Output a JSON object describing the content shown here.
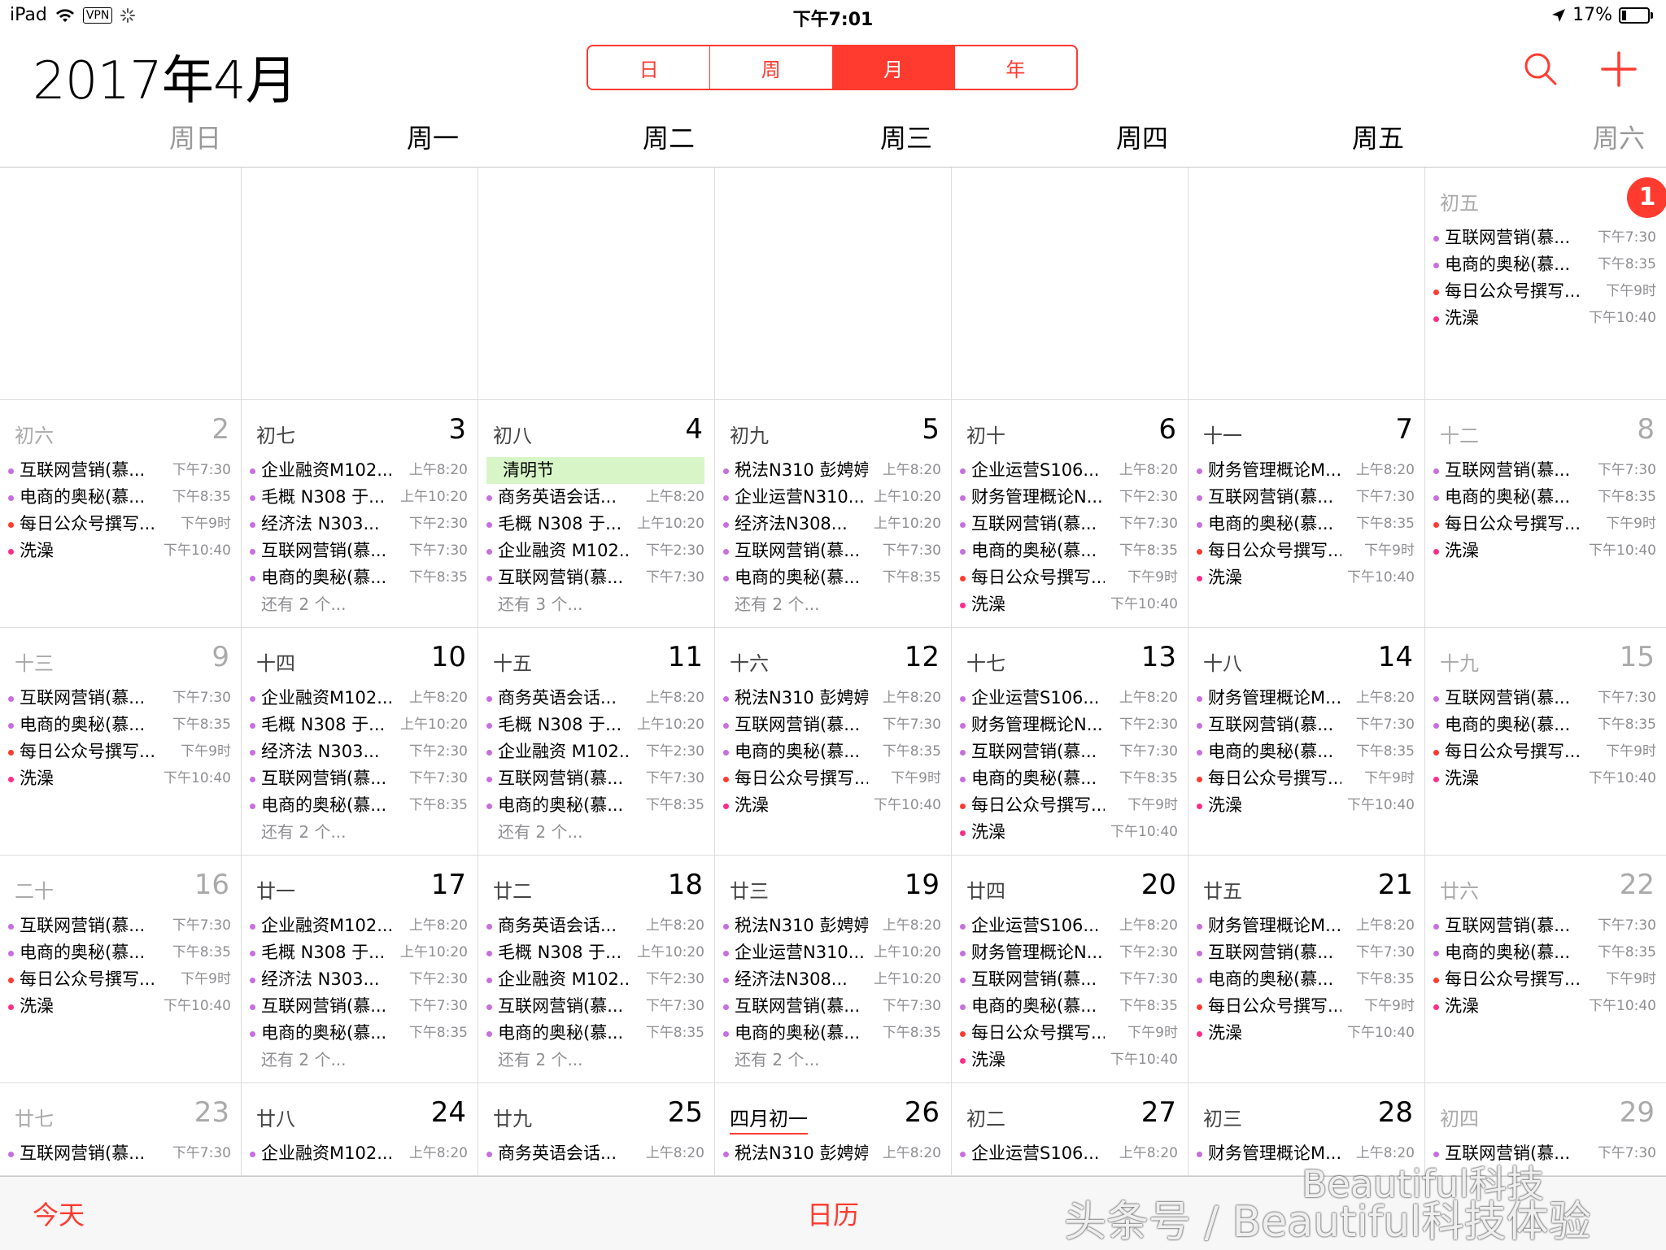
{
  "status": {
    "device": "iPad",
    "vpn": "VPN",
    "time": "下午7:01",
    "battery_text": "17%",
    "battery_level": 0.17
  },
  "header": {
    "title": "2017年4月"
  },
  "segments": [
    {
      "label": "日",
      "active": false
    },
    {
      "label": "周",
      "active": false
    },
    {
      "label": "月",
      "active": true
    },
    {
      "label": "年",
      "active": false
    }
  ],
  "icons": {
    "search": "search-icon",
    "add": "plus-icon",
    "accent": "#ff3b30"
  },
  "weekdays": [
    "周日",
    "周一",
    "周二",
    "周三",
    "周四",
    "周五",
    "周六"
  ],
  "toolbar": {
    "today": "今天",
    "calendars": "日历"
  },
  "watermark": {
    "line1": "Beautiful科技",
    "line2": "头条号 / Beautiful科技体验"
  },
  "weeks": [
    [
      null,
      null,
      null,
      null,
      null,
      null,
      {
        "lunar": "初五",
        "day": "1",
        "today": true,
        "events": [
          {
            "title": "互联网营销(慕...",
            "time": "下午7:30",
            "color": "#c86ee0"
          },
          {
            "title": "电商的奥秘(慕...",
            "time": "下午8:35",
            "color": "#c86ee0"
          },
          {
            "title": "每日公众号撰写...",
            "time": "下午9时",
            "color": "#ff3b30"
          },
          {
            "title": "洗澡",
            "time": "下午10:40",
            "color": "#ff2d8a"
          }
        ]
      }
    ],
    [
      {
        "lunar": "初六",
        "day": "2",
        "events": [
          {
            "title": "互联网营销(慕...",
            "time": "下午7:30",
            "color": "#c86ee0"
          },
          {
            "title": "电商的奥秘(慕...",
            "time": "下午8:35",
            "color": "#c86ee0"
          },
          {
            "title": "每日公众号撰写...",
            "time": "下午9时",
            "color": "#ff3b30"
          },
          {
            "title": "洗澡",
            "time": "下午10:40",
            "color": "#ff2d8a"
          }
        ]
      },
      {
        "lunar": "初七",
        "day": "3",
        "more": "还有 2 个...",
        "events": [
          {
            "title": "企业融资M102...",
            "time": "上午8:20",
            "color": "#c86ee0"
          },
          {
            "title": "毛概 N308 于...",
            "time": "上午10:20",
            "color": "#c86ee0"
          },
          {
            "title": "经济法 N303...",
            "time": "下午2:30",
            "color": "#c86ee0"
          },
          {
            "title": "互联网营销(慕...",
            "time": "下午7:30",
            "color": "#c86ee0"
          },
          {
            "title": "电商的奥秘(慕...",
            "time": "下午8:35",
            "color": "#c86ee0"
          }
        ]
      },
      {
        "lunar": "初八",
        "day": "4",
        "more": "还有 3 个...",
        "allday": "清明节",
        "events": [
          {
            "title": "商务英语会话...",
            "time": "上午8:20",
            "color": "#c86ee0"
          },
          {
            "title": "毛概 N308 于...",
            "time": "上午10:20",
            "color": "#c86ee0"
          },
          {
            "title": "企业融资 M102...",
            "time": "下午2:30",
            "color": "#c86ee0"
          },
          {
            "title": "互联网营销(慕...",
            "time": "下午7:30",
            "color": "#c86ee0"
          }
        ]
      },
      {
        "lunar": "初九",
        "day": "5",
        "more": "还有 2 个...",
        "events": [
          {
            "title": "税法N310 彭娉婷",
            "time": "上午8:20",
            "color": "#c86ee0"
          },
          {
            "title": "企业运营N310...",
            "time": "上午10:20",
            "color": "#c86ee0"
          },
          {
            "title": "经济法N308...",
            "time": "上午10:20",
            "color": "#c86ee0"
          },
          {
            "title": "互联网营销(慕...",
            "time": "下午7:30",
            "color": "#c86ee0"
          },
          {
            "title": "电商的奥秘(慕...",
            "time": "下午8:35",
            "color": "#c86ee0"
          }
        ]
      },
      {
        "lunar": "初十",
        "day": "6",
        "events": [
          {
            "title": "企业运营S106...",
            "time": "上午8:20",
            "color": "#c86ee0"
          },
          {
            "title": "财务管理概论N...",
            "time": "下午2:30",
            "color": "#c86ee0"
          },
          {
            "title": "互联网营销(慕...",
            "time": "下午7:30",
            "color": "#c86ee0"
          },
          {
            "title": "电商的奥秘(慕...",
            "time": "下午8:35",
            "color": "#c86ee0"
          },
          {
            "title": "每日公众号撰写...",
            "time": "下午9时",
            "color": "#ff3b30"
          },
          {
            "title": "洗澡",
            "time": "下午10:40",
            "color": "#ff2d8a"
          }
        ]
      },
      {
        "lunar": "十一",
        "day": "7",
        "events": [
          {
            "title": "财务管理概论M...",
            "time": "上午8:20",
            "color": "#c86ee0"
          },
          {
            "title": "互联网营销(慕...",
            "time": "下午7:30",
            "color": "#c86ee0"
          },
          {
            "title": "电商的奥秘(慕...",
            "time": "下午8:35",
            "color": "#c86ee0"
          },
          {
            "title": "每日公众号撰写...",
            "time": "下午9时",
            "color": "#ff3b30"
          },
          {
            "title": "洗澡",
            "time": "下午10:40",
            "color": "#ff2d8a"
          }
        ]
      },
      {
        "lunar": "十二",
        "day": "8",
        "events": [
          {
            "title": "互联网营销(慕...",
            "time": "下午7:30",
            "color": "#c86ee0"
          },
          {
            "title": "电商的奥秘(慕...",
            "time": "下午8:35",
            "color": "#c86ee0"
          },
          {
            "title": "每日公众号撰写...",
            "time": "下午9时",
            "color": "#ff3b30"
          },
          {
            "title": "洗澡",
            "time": "下午10:40",
            "color": "#ff2d8a"
          }
        ]
      }
    ],
    [
      {
        "lunar": "十三",
        "day": "9",
        "events": [
          {
            "title": "互联网营销(慕...",
            "time": "下午7:30",
            "color": "#c86ee0"
          },
          {
            "title": "电商的奥秘(慕...",
            "time": "下午8:35",
            "color": "#c86ee0"
          },
          {
            "title": "每日公众号撰写...",
            "time": "下午9时",
            "color": "#ff3b30"
          },
          {
            "title": "洗澡",
            "time": "下午10:40",
            "color": "#ff2d8a"
          }
        ]
      },
      {
        "lunar": "十四",
        "day": "10",
        "more": "还有 2 个...",
        "events": [
          {
            "title": "企业融资M102...",
            "time": "上午8:20",
            "color": "#c86ee0"
          },
          {
            "title": "毛概 N308 于...",
            "time": "上午10:20",
            "color": "#c86ee0"
          },
          {
            "title": "经济法 N303...",
            "time": "下午2:30",
            "color": "#c86ee0"
          },
          {
            "title": "互联网营销(慕...",
            "time": "下午7:30",
            "color": "#c86ee0"
          },
          {
            "title": "电商的奥秘(慕...",
            "time": "下午8:35",
            "color": "#c86ee0"
          }
        ]
      },
      {
        "lunar": "十五",
        "day": "11",
        "more": "还有 2 个...",
        "events": [
          {
            "title": "商务英语会话...",
            "time": "上午8:20",
            "color": "#c86ee0"
          },
          {
            "title": "毛概 N308 于...",
            "time": "上午10:20",
            "color": "#c86ee0"
          },
          {
            "title": "企业融资 M102...",
            "time": "下午2:30",
            "color": "#c86ee0"
          },
          {
            "title": "互联网营销(慕...",
            "time": "下午7:30",
            "color": "#c86ee0"
          },
          {
            "title": "电商的奥秘(慕...",
            "time": "下午8:35",
            "color": "#c86ee0"
          }
        ]
      },
      {
        "lunar": "十六",
        "day": "12",
        "events": [
          {
            "title": "税法N310 彭娉婷",
            "time": "上午8:20",
            "color": "#c86ee0"
          },
          {
            "title": "互联网营销(慕...",
            "time": "下午7:30",
            "color": "#c86ee0"
          },
          {
            "title": "电商的奥秘(慕...",
            "time": "下午8:35",
            "color": "#c86ee0"
          },
          {
            "title": "每日公众号撰写...",
            "time": "下午9时",
            "color": "#ff3b30"
          },
          {
            "title": "洗澡",
            "time": "下午10:40",
            "color": "#ff2d8a"
          }
        ]
      },
      {
        "lunar": "十七",
        "day": "13",
        "events": [
          {
            "title": "企业运营S106...",
            "time": "上午8:20",
            "color": "#c86ee0"
          },
          {
            "title": "财务管理概论N...",
            "time": "下午2:30",
            "color": "#c86ee0"
          },
          {
            "title": "互联网营销(慕...",
            "time": "下午7:30",
            "color": "#c86ee0"
          },
          {
            "title": "电商的奥秘(慕...",
            "time": "下午8:35",
            "color": "#c86ee0"
          },
          {
            "title": "每日公众号撰写...",
            "time": "下午9时",
            "color": "#ff3b30"
          },
          {
            "title": "洗澡",
            "time": "下午10:40",
            "color": "#ff2d8a"
          }
        ]
      },
      {
        "lunar": "十八",
        "day": "14",
        "events": [
          {
            "title": "财务管理概论M...",
            "time": "上午8:20",
            "color": "#c86ee0"
          },
          {
            "title": "互联网营销(慕...",
            "time": "下午7:30",
            "color": "#c86ee0"
          },
          {
            "title": "电商的奥秘(慕...",
            "time": "下午8:35",
            "color": "#c86ee0"
          },
          {
            "title": "每日公众号撰写...",
            "time": "下午9时",
            "color": "#ff3b30"
          },
          {
            "title": "洗澡",
            "time": "下午10:40",
            "color": "#ff2d8a"
          }
        ]
      },
      {
        "lunar": "十九",
        "day": "15",
        "events": [
          {
            "title": "互联网营销(慕...",
            "time": "下午7:30",
            "color": "#c86ee0"
          },
          {
            "title": "电商的奥秘(慕...",
            "time": "下午8:35",
            "color": "#c86ee0"
          },
          {
            "title": "每日公众号撰写...",
            "time": "下午9时",
            "color": "#ff3b30"
          },
          {
            "title": "洗澡",
            "time": "下午10:40",
            "color": "#ff2d8a"
          }
        ]
      }
    ],
    [
      {
        "lunar": "二十",
        "day": "16",
        "events": [
          {
            "title": "互联网营销(慕...",
            "time": "下午7:30",
            "color": "#c86ee0"
          },
          {
            "title": "电商的奥秘(慕...",
            "time": "下午8:35",
            "color": "#c86ee0"
          },
          {
            "title": "每日公众号撰写...",
            "time": "下午9时",
            "color": "#ff3b30"
          },
          {
            "title": "洗澡",
            "time": "下午10:40",
            "color": "#ff2d8a"
          }
        ]
      },
      {
        "lunar": "廿一",
        "day": "17",
        "more": "还有 2 个...",
        "events": [
          {
            "title": "企业融资M102...",
            "time": "上午8:20",
            "color": "#c86ee0"
          },
          {
            "title": "毛概 N308 于...",
            "time": "上午10:20",
            "color": "#c86ee0"
          },
          {
            "title": "经济法 N303...",
            "time": "下午2:30",
            "color": "#c86ee0"
          },
          {
            "title": "互联网营销(慕...",
            "time": "下午7:30",
            "color": "#c86ee0"
          },
          {
            "title": "电商的奥秘(慕...",
            "time": "下午8:35",
            "color": "#c86ee0"
          }
        ]
      },
      {
        "lunar": "廿二",
        "day": "18",
        "more": "还有 2 个...",
        "events": [
          {
            "title": "商务英语会话...",
            "time": "上午8:20",
            "color": "#c86ee0"
          },
          {
            "title": "毛概 N308 于...",
            "time": "上午10:20",
            "color": "#c86ee0"
          },
          {
            "title": "企业融资 M102...",
            "time": "下午2:30",
            "color": "#c86ee0"
          },
          {
            "title": "互联网营销(慕...",
            "time": "下午7:30",
            "color": "#c86ee0"
          },
          {
            "title": "电商的奥秘(慕...",
            "time": "下午8:35",
            "color": "#c86ee0"
          }
        ]
      },
      {
        "lunar": "廿三",
        "day": "19",
        "more": "还有 2 个...",
        "events": [
          {
            "title": "税法N310 彭娉婷",
            "time": "上午8:20",
            "color": "#c86ee0"
          },
          {
            "title": "企业运营N310...",
            "time": "上午10:20",
            "color": "#c86ee0"
          },
          {
            "title": "经济法N308...",
            "time": "上午10:20",
            "color": "#c86ee0"
          },
          {
            "title": "互联网营销(慕...",
            "time": "下午7:30",
            "color": "#c86ee0"
          },
          {
            "title": "电商的奥秘(慕...",
            "time": "下午8:35",
            "color": "#c86ee0"
          }
        ]
      },
      {
        "lunar": "廿四",
        "day": "20",
        "events": [
          {
            "title": "企业运营S106...",
            "time": "上午8:20",
            "color": "#c86ee0"
          },
          {
            "title": "财务管理概论N...",
            "time": "下午2:30",
            "color": "#c86ee0"
          },
          {
            "title": "互联网营销(慕...",
            "time": "下午7:30",
            "color": "#c86ee0"
          },
          {
            "title": "电商的奥秘(慕...",
            "time": "下午8:35",
            "color": "#c86ee0"
          },
          {
            "title": "每日公众号撰写...",
            "time": "下午9时",
            "color": "#ff3b30"
          },
          {
            "title": "洗澡",
            "time": "下午10:40",
            "color": "#ff2d8a"
          }
        ]
      },
      {
        "lunar": "廿五",
        "day": "21",
        "events": [
          {
            "title": "财务管理概论M...",
            "time": "上午8:20",
            "color": "#c86ee0"
          },
          {
            "title": "互联网营销(慕...",
            "time": "下午7:30",
            "color": "#c86ee0"
          },
          {
            "title": "电商的奥秘(慕...",
            "time": "下午8:35",
            "color": "#c86ee0"
          },
          {
            "title": "每日公众号撰写...",
            "time": "下午9时",
            "color": "#ff3b30"
          },
          {
            "title": "洗澡",
            "time": "下午10:40",
            "color": "#ff2d8a"
          }
        ]
      },
      {
        "lunar": "廿六",
        "day": "22",
        "events": [
          {
            "title": "互联网营销(慕...",
            "time": "下午7:30",
            "color": "#c86ee0"
          },
          {
            "title": "电商的奥秘(慕...",
            "time": "下午8:35",
            "color": "#c86ee0"
          },
          {
            "title": "每日公众号撰写...",
            "time": "下午9时",
            "color": "#ff3b30"
          },
          {
            "title": "洗澡",
            "time": "下午10:40",
            "color": "#ff2d8a"
          }
        ]
      }
    ],
    [
      {
        "lunar": "廿七",
        "day": "23",
        "events": [
          {
            "title": "互联网营销(慕...",
            "time": "下午7:30",
            "color": "#c86ee0"
          }
        ]
      },
      {
        "lunar": "廿八",
        "day": "24",
        "events": [
          {
            "title": "企业融资M102...",
            "time": "上午8:20",
            "color": "#c86ee0"
          }
        ]
      },
      {
        "lunar": "廿九",
        "day": "25",
        "events": [
          {
            "title": "商务英语会话...",
            "time": "上午8:20",
            "color": "#c86ee0"
          }
        ]
      },
      {
        "lunar": "四月初一",
        "day": "26",
        "special": true,
        "events": [
          {
            "title": "税法N310 彭娉婷",
            "time": "上午8:20",
            "color": "#c86ee0"
          }
        ]
      },
      {
        "lunar": "初二",
        "day": "27",
        "events": [
          {
            "title": "企业运营S106...",
            "time": "上午8:20",
            "color": "#c86ee0"
          }
        ]
      },
      {
        "lunar": "初三",
        "day": "28",
        "events": [
          {
            "title": "财务管理概论M...",
            "time": "上午8:20",
            "color": "#c86ee0"
          }
        ]
      },
      {
        "lunar": "初四",
        "day": "29",
        "events": [
          {
            "title": "互联网营销(慕...",
            "time": "下午7:30",
            "color": "#c86ee0"
          }
        ]
      }
    ]
  ]
}
